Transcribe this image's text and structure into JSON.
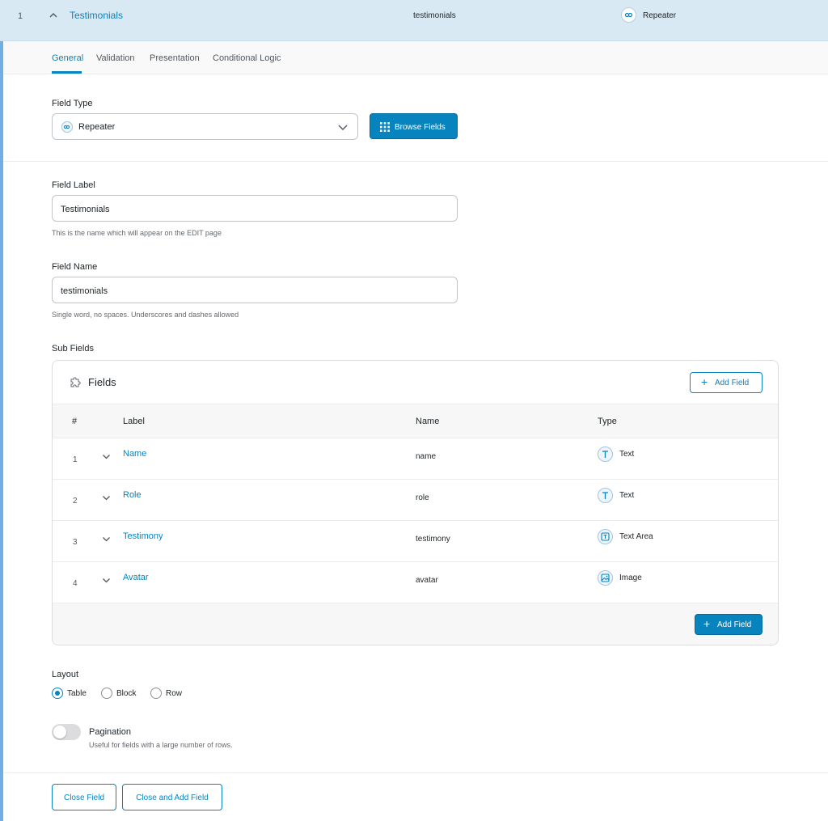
{
  "header": {
    "order": "1",
    "label": "Testimonials",
    "name": "testimonials",
    "type": "Repeater"
  },
  "tabs": [
    {
      "label": "General",
      "active": true
    },
    {
      "label": "Validation"
    },
    {
      "label": "Presentation"
    },
    {
      "label": "Conditional Logic"
    }
  ],
  "field_type": {
    "label": "Field Type",
    "value": "Repeater",
    "browse_label": "Browse Fields"
  },
  "field_label": {
    "label": "Field Label",
    "value": "Testimonials",
    "hint": "This is the name which will appear on the EDIT page"
  },
  "field_name": {
    "label": "Field Name",
    "value": "testimonials",
    "hint": "Single word, no spaces. Underscores and dashes allowed"
  },
  "sub_fields": {
    "label": "Sub Fields",
    "title": "Fields",
    "add_label": "Add Field",
    "columns": {
      "num": "#",
      "label": "Label",
      "name": "Name",
      "type": "Type"
    },
    "rows": [
      {
        "num": "1",
        "label": "Name",
        "name": "name",
        "type": "Text",
        "icon": "text-icon"
      },
      {
        "num": "2",
        "label": "Role",
        "name": "role",
        "type": "Text",
        "icon": "text-icon"
      },
      {
        "num": "3",
        "label": "Testimony",
        "name": "testimony",
        "type": "Text Area",
        "icon": "textarea-icon"
      },
      {
        "num": "4",
        "label": "Avatar",
        "name": "avatar",
        "type": "Image",
        "icon": "image-icon"
      }
    ]
  },
  "layout": {
    "label": "Layout",
    "options": [
      {
        "label": "Table",
        "checked": true
      },
      {
        "label": "Block",
        "checked": false
      },
      {
        "label": "Row",
        "checked": false
      }
    ]
  },
  "pagination": {
    "label": "Pagination",
    "hint": "Useful for fields with a large number of rows.",
    "enabled": false
  },
  "actions": {
    "close": "Close Field",
    "close_add": "Close and Add Field"
  },
  "colors": {
    "accent": "#0783be",
    "header_bg": "#d9e9f4",
    "left_accent": "#72aee6"
  }
}
